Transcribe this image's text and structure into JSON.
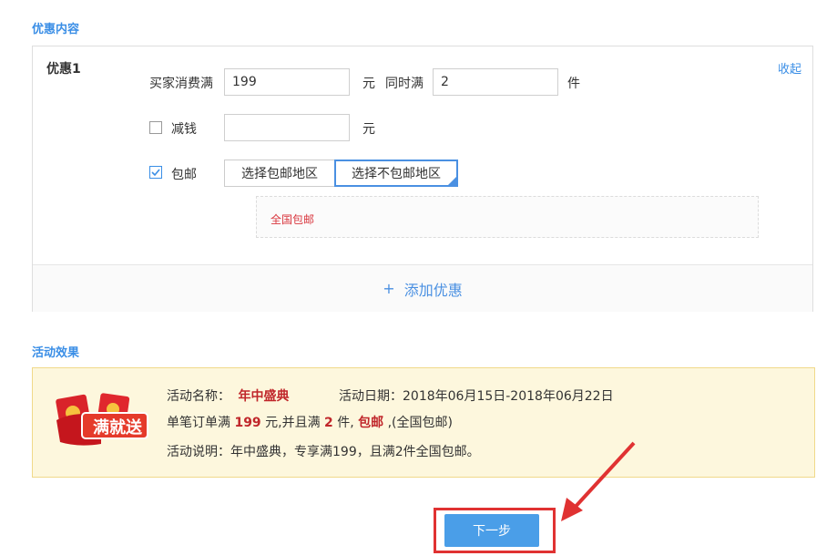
{
  "discount_section": {
    "title": "优惠内容",
    "item_title": "优惠1",
    "collapse_label": "收起",
    "buyer_spend_label": "买家消费满",
    "buyer_spend_value": "199",
    "yuan_unit_1": "元",
    "also_reach_label": "同时满",
    "also_reach_value": "2",
    "item_unit": "件",
    "reduce_label": "减钱",
    "reduce_value": "",
    "reduce_checked": false,
    "yuan_unit_2": "元",
    "free_ship_label": "包邮",
    "free_ship_checked": true,
    "select_ship_region_label": "选择包邮地区",
    "select_no_ship_region_label": "选择不包邮地区",
    "region_text": "全国包邮",
    "add_discount_plus": "+",
    "add_discount_label": "添加优惠"
  },
  "effect_section": {
    "title": "活动效果",
    "badge_text": "满就送",
    "name_label": "活动名称：",
    "name_value": "年中盛典",
    "date_label": "活动日期：",
    "date_value": "2018年06月15日-2018年06月22日",
    "line2_pre": "单笔订单满 ",
    "line2_amount": "199",
    "line2_mid": " 元,并且满 ",
    "line2_count": "2",
    "line2_mid2": " 件, ",
    "line2_free": "包邮",
    "line2_post": " ,(全国包邮)",
    "desc_label": "活动说明：",
    "desc_value": "年中盛典，专享满199，且满2件全国包邮。"
  },
  "next_button_label": "下一步",
  "colors": {
    "accent": "#4a90e2",
    "highlight": "#e03232",
    "emphasis": "#c0262a"
  }
}
